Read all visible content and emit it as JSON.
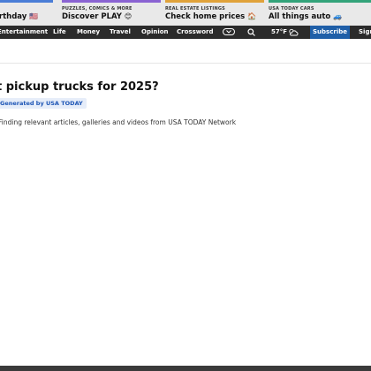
{
  "promo_strip": {
    "items": [
      {
        "kicker": "",
        "title": "irthday",
        "emoji": "🇺🇸"
      },
      {
        "kicker": "PUZZLES, COMICS & MORE",
        "title": "Discover PLAY",
        "emoji": "😊"
      },
      {
        "kicker": "REAL ESTATE LISTINGS",
        "title": "Check home prices",
        "emoji": "🏠"
      },
      {
        "kicker": "USA TODAY CARS",
        "title": "All things auto",
        "emoji": "🚙"
      }
    ],
    "colors": [
      "#4a7dd6",
      "#8a63d2",
      "#e0a23a",
      "#33a37a"
    ]
  },
  "nav": {
    "items": [
      "Entertainment",
      "Life",
      "Money",
      "Travel",
      "Opinion",
      "Crossword"
    ],
    "more_icon": "chevron-down-icon",
    "search_icon": "search-icon",
    "temperature": "57°F",
    "weather_icon": "partly-cloudy-icon",
    "subscribe_label": "Subscribe",
    "signin_label": "Sign",
    "subscribe_color": "#1f5fa8"
  },
  "main": {
    "headline": "t pickup trucks for 2025?",
    "badge": "Generated by USA TODAY",
    "status": "Finding relevant articles, galleries and videos from USA TODAY Network"
  }
}
